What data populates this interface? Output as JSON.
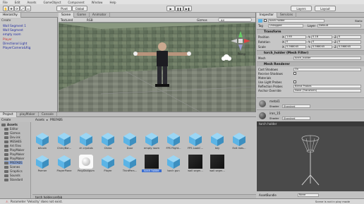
{
  "menu": [
    "File",
    "Edit",
    "Assets",
    "GameObject",
    "Component",
    "Window",
    "Help"
  ],
  "toolbar": {
    "pivot": "Pivot",
    "global": "Global",
    "account": "Account",
    "layers": "Layers",
    "layout": "Layout"
  },
  "hierarchy": {
    "tab": "Hierarchy",
    "create": "Create",
    "items": [
      "Wall Segment 1",
      "Wall Segment",
      "empty room",
      "Player",
      "Directional Light",
      "PlayerCamera&Rig"
    ]
  },
  "scene": {
    "tabs": [
      "Scene",
      "Game",
      "Animator"
    ],
    "shading": "Textured",
    "rgb": "RGB",
    "gizmos": "Gizmos",
    "search": "All",
    "gizmo_label": "Persp"
  },
  "inspector": {
    "tabs": [
      "Inspector",
      "Services"
    ],
    "object_name": "torch holder",
    "static": "Static",
    "tag_label": "Tag",
    "tag_value": "Untagged",
    "layer_label": "Layer",
    "layer_value": "Default",
    "transform": {
      "title": "Transform",
      "position_label": "Position",
      "rotation_label": "Rotation",
      "scale_label": "Scale",
      "x_label": "X",
      "y_label": "Y",
      "z_label": "Z",
      "position": [
        "1.65",
        "0.18",
        "0"
      ],
      "rotation": [
        "0",
        "0",
        "0"
      ],
      "scale": [
        "0.568045",
        "0.568045",
        "0.568045"
      ]
    },
    "mesh_filter": {
      "title": "torch_holder (Mesh Filter)",
      "mesh_label": "Mesh",
      "mesh_value": "torch_holder"
    },
    "mesh_renderer": {
      "title": "Mesh Renderer",
      "rows": [
        {
          "label": "Cast Shadows",
          "value": "On"
        },
        {
          "label": "Receive Shadows",
          "value": ""
        },
        {
          "label": "Materials",
          "value": ""
        },
        {
          "label": "Use Light Probes",
          "value": ""
        },
        {
          "label": "Reflection Probes",
          "value": "Blend Probes"
        },
        {
          "label": "Anchor Override",
          "value": "None (Transform)"
        }
      ]
    },
    "materials": [
      {
        "name": "metal1",
        "shader_label": "Shader",
        "shader": "Standard"
      },
      {
        "name": "iron_15",
        "shader_label": "Shader",
        "shader": "Standard"
      }
    ]
  },
  "project": {
    "tabs": [
      "Project",
      "playMaker",
      "Console"
    ],
    "create": "Create",
    "path": [
      "Assets",
      "PREFABS"
    ],
    "tree": [
      "Assets",
      "Editor",
      "Gizmos",
      "Dev.ink",
      "MESHES",
      "Art Files",
      "PlayMaker",
      "PlayMaker",
      "PlayMaker",
      "PREFABS",
      "Scenes",
      "Graphics",
      "Sounds",
      "Standard"
    ],
    "assets_row1": [
      "bitcoin",
      "ChirryBor...",
      "ch crystals",
      "Chess",
      "Door",
      "empty room",
      "FPS Flight...",
      "FPS LookC...",
      "key",
      "Exit mes..."
    ],
    "assets_row2": [
      "Parmer",
      "PlayerPlane",
      "PingShotgum",
      "Player",
      "ThirdPers...",
      "torch holder",
      "torch gun",
      "wall segm...",
      "wall segm..."
    ],
    "footer_file": "torch holder.prefab",
    "asset_bundle": "AssetBundle"
  },
  "preview": {
    "title": "torch holder",
    "footer": "None"
  },
  "status": "Parameter 'Velocity' does not exist.",
  "status_right": "Scene is not in play mode",
  "colors": {
    "selected": "#3b6ed0",
    "cube": "#5bb4e6",
    "scene_floor": "#6e7566"
  }
}
